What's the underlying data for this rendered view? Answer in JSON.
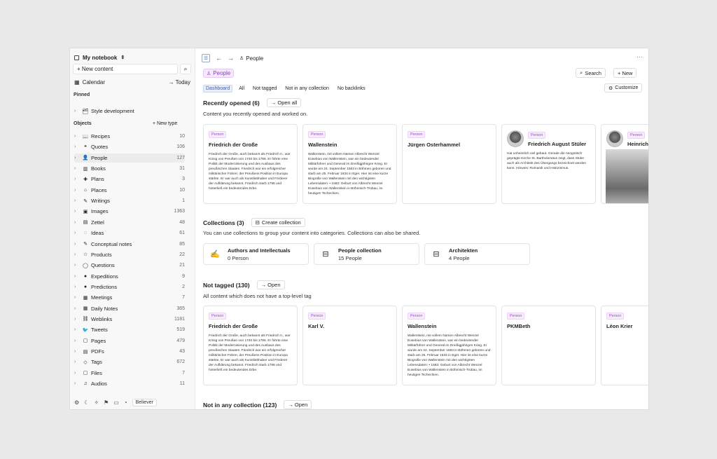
{
  "sidebar": {
    "notebook_title": "My notebook",
    "new_content": "+ New content",
    "calendar": "Calendar",
    "today": "→ Today",
    "pinned_label": "Pinned",
    "pinned_item": "Style development",
    "objects_label": "Objects",
    "new_type": "+ New type",
    "objects": [
      {
        "label": "Recipes",
        "count": "10",
        "icon": "📖"
      },
      {
        "label": "Quotes",
        "count": "106",
        "icon": "❝"
      },
      {
        "label": "People",
        "count": "127",
        "icon": "👤"
      },
      {
        "label": "Books",
        "count": "31",
        "icon": "▥"
      },
      {
        "label": "Plans",
        "count": "3",
        "icon": "✚"
      },
      {
        "label": "Places",
        "count": "10",
        "icon": "⌂"
      },
      {
        "label": "Writings",
        "count": "1",
        "icon": "✎"
      },
      {
        "label": "Images",
        "count": "1363",
        "icon": "▣"
      },
      {
        "label": "Zettel",
        "count": "48",
        "icon": "▤"
      },
      {
        "label": "Ideas",
        "count": "61",
        "icon": "◌"
      },
      {
        "label": "Conceptual notes",
        "count": "85",
        "icon": "✎"
      },
      {
        "label": "Products",
        "count": "22",
        "icon": "☆"
      },
      {
        "label": "Questions",
        "count": "21",
        "icon": "◯"
      },
      {
        "label": "Expeditions",
        "count": "9",
        "icon": "●"
      },
      {
        "label": "Predictions",
        "count": "2",
        "icon": "●"
      },
      {
        "label": "Meetings",
        "count": "7",
        "icon": "▦"
      },
      {
        "label": "Daily Notes",
        "count": "365",
        "icon": "▦"
      },
      {
        "label": "Weblinks",
        "count": "1181",
        "icon": "⛓"
      },
      {
        "label": "Tweets",
        "count": "519",
        "icon": "🐦"
      },
      {
        "label": "Pages",
        "count": "479",
        "icon": "▢"
      },
      {
        "label": "PDFs",
        "count": "43",
        "icon": "▤"
      },
      {
        "label": "Tags",
        "count": "672",
        "icon": "◇"
      },
      {
        "label": "Files",
        "count": "7",
        "icon": "▢"
      },
      {
        "label": "Audios",
        "count": "11",
        "icon": "♫"
      }
    ],
    "footer_badge": "Believer"
  },
  "topbar": {
    "breadcrumb": "People"
  },
  "header": {
    "people_tag": "People",
    "search": "Search",
    "new": "+ New",
    "customize": "Customize"
  },
  "filters": [
    "Dashboard",
    "All",
    "Not tagged",
    "Not in any collection",
    "No backlinks"
  ],
  "recent": {
    "title": "Recently opened (6)",
    "button": "→ Open all",
    "desc": "Content you recently opened and worked on.",
    "cards": [
      {
        "badge": "Person",
        "title": "Friedrich der Große",
        "text": "Friedrich der Große, auch bekannt als Friedrich II., war König von Preußen von 1740 bis 1786. Er führte eine Politik der Modernisierung und des Ausbaus des preußischen Staates. Friedrich war ein erfolgreicher militärischer Führer, der Preußens Position in Europa stärkte. Er war auch als Kunstliebhaber und Förderer der Aufklärung bekannt. Friedrich starb 1786 und hinterließ ein bedeutendes Erbe."
      },
      {
        "badge": "Person",
        "title": "Wallenstein",
        "text": "Wallenstein, mit vollem Namen Albrecht Wenzel Eusebius von Wallenstein, war ein bedeutender Militärführer und General im Dreißigjährigen Krieg. Er wurde am 24. September 1583 in Böhmen geboren und starb am 25. Februar 1634 in Eger. Hier ist eine kurze Biografie von Wallenstein mit den wichtigsten Lebensdaten: • 1583: Geburt von Albrecht Wenzel Eusebius von Wallenstein in Böhmisch-Trübau, im heutigen Tschechien."
      },
      {
        "badge": "Person",
        "title": "Jürgen Osterhammel",
        "text": ""
      },
      {
        "badge": "Person",
        "title": "Friedrich August Stüler",
        "text": "Hat unheimlich viel gebaut. Gerade die neogotisch geprägte Kirche St. Bartholomäus zeigt, dass Stüler auch als Architekt des Übergangs bezeichnet werden kann. Hinweis: Romanik und Historismus."
      },
      {
        "badge": "Person",
        "title": "Heinrich",
        "text": ""
      }
    ]
  },
  "collections": {
    "title": "Collections (3)",
    "button": "Create collection",
    "desc": "You can use collections to group your content into categories. Collections can also be shared.",
    "items": [
      {
        "name": "Authors and Intellectuals",
        "count": "0 Person",
        "icon": "✍"
      },
      {
        "name": "People collection",
        "count": "15 People",
        "icon": "⊟"
      },
      {
        "name": "Architekten",
        "count": "4 People",
        "icon": "⊟"
      }
    ]
  },
  "not_tagged": {
    "title": "Not tagged (130)",
    "button": "→ Open",
    "desc": "All content which does not have a top-level tag",
    "cards": [
      {
        "badge": "Person",
        "title": "Friedrich der Große",
        "text": "Friedrich der Große, auch bekannt als Friedrich II., war König von Preußen von 1740 bis 1786. Er führte eine Politik der Modernisierung und des Ausbaus des preußischen Staates. Friedrich war ein erfolgreicher militärischer Führer, der Preußens Position in Europa stärkte. Er war auch als Kunstliebhaber und Förderer der Aufklärung bekannt. Friedrich starb 1786 und hinterließ ein bedeutendes Erbe."
      },
      {
        "badge": "Person",
        "title": "Karl V.",
        "text": ""
      },
      {
        "badge": "Person",
        "title": "Wallenstein",
        "text": "Wallenstein, mit vollem Namen Albrecht Wenzel Eusebius von Wallenstein, war ein bedeutender Militärführer und General im Dreißigjährigen Krieg. Er wurde am 24. September 1583 in Böhmen geboren und starb am 25. Februar 1634 in Eger. Hier ist eine kurze Biografie von Wallenstein mit den wichtigsten Lebensdaten: • 1583: Geburt von Albrecht Wenzel Eusebius von Wallenstein in Böhmisch-Trübau, im heutigen Tschechien."
      },
      {
        "badge": "Person",
        "title": "PKMBeth",
        "text": ""
      },
      {
        "badge": "Person",
        "title": "Léon Krier",
        "text": ""
      }
    ]
  },
  "not_in_collection": {
    "title": "Not in any collection (123)",
    "button": "→ Open"
  }
}
